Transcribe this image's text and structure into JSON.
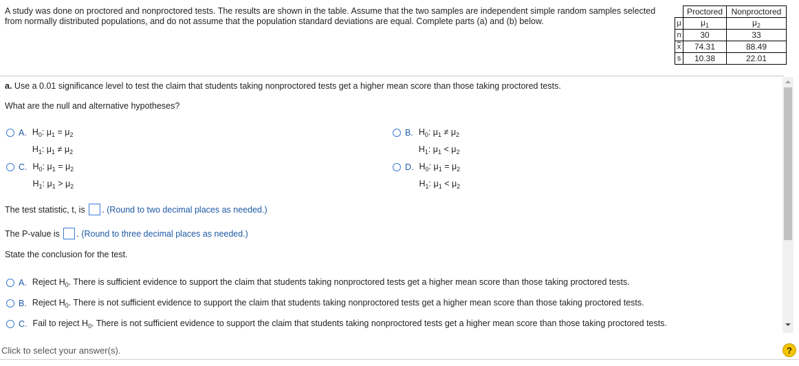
{
  "intro": "A study was done on proctored and nonproctored tests. The results are shown in the table. Assume that the two samples are independent simple random samples selected from normally distributed populations, and do not assume that the population standard deviations are equal. Complete parts (a) and (b) below.",
  "table": {
    "headers": [
      "Proctored",
      "Nonproctored"
    ],
    "rows": [
      {
        "label": "μ",
        "values": [
          "μ1",
          "μ2"
        ]
      },
      {
        "label": "n",
        "values": [
          "30",
          "33"
        ]
      },
      {
        "label": "x",
        "values": [
          "74.31",
          "88.49"
        ]
      },
      {
        "label": "s",
        "values": [
          "10.38",
          "22.01"
        ]
      }
    ]
  },
  "part_a": {
    "prefix": "a.",
    "question": "Use a 0.01 significance level to test the claim that students taking nonproctored tests get a higher mean score than those taking proctored tests.",
    "hypotheses_prompt": "What are the null and alternative hypotheses?",
    "options": [
      {
        "letter": "A.",
        "h0": "μ1 = μ2",
        "h1": "μ1 ≠ μ2"
      },
      {
        "letter": "B.",
        "h0": "μ1 ≠ μ2",
        "h1": "μ1 < μ2"
      },
      {
        "letter": "C.",
        "h0": "μ1 = μ2",
        "h1": "μ1 > μ2"
      },
      {
        "letter": "D.",
        "h0": "μ1 = μ2",
        "h1": "μ1 < μ2"
      }
    ],
    "test_stat_label": "The test statistic, t, is",
    "test_stat_hint": "(Round to two decimal places as needed.)",
    "pvalue_label": "The P-value is",
    "pvalue_hint": "(Round to three decimal places as needed.)",
    "conclusion_prompt": "State the conclusion for the test.",
    "conclusions": [
      {
        "letter": "A.",
        "text": "Reject H0. There is sufficient evidence to support the claim that students taking nonproctored tests get a higher mean score than those taking proctored tests."
      },
      {
        "letter": "B.",
        "text": "Reject H0. There is not sufficient evidence to support the claim that students taking nonproctored tests get a higher mean score than those taking proctored tests."
      },
      {
        "letter": "C.",
        "text": "Fail to reject H0. There is not sufficient evidence to support the claim that students taking nonproctored tests get a higher mean score than those taking proctored tests."
      }
    ]
  },
  "footer": {
    "instruction": "Click to select your answer(s).",
    "help_label": "?"
  },
  "colors": {
    "accent": "#1f5aa6",
    "radio_border": "#3a7bd5",
    "help_bg": "#f5c400"
  }
}
